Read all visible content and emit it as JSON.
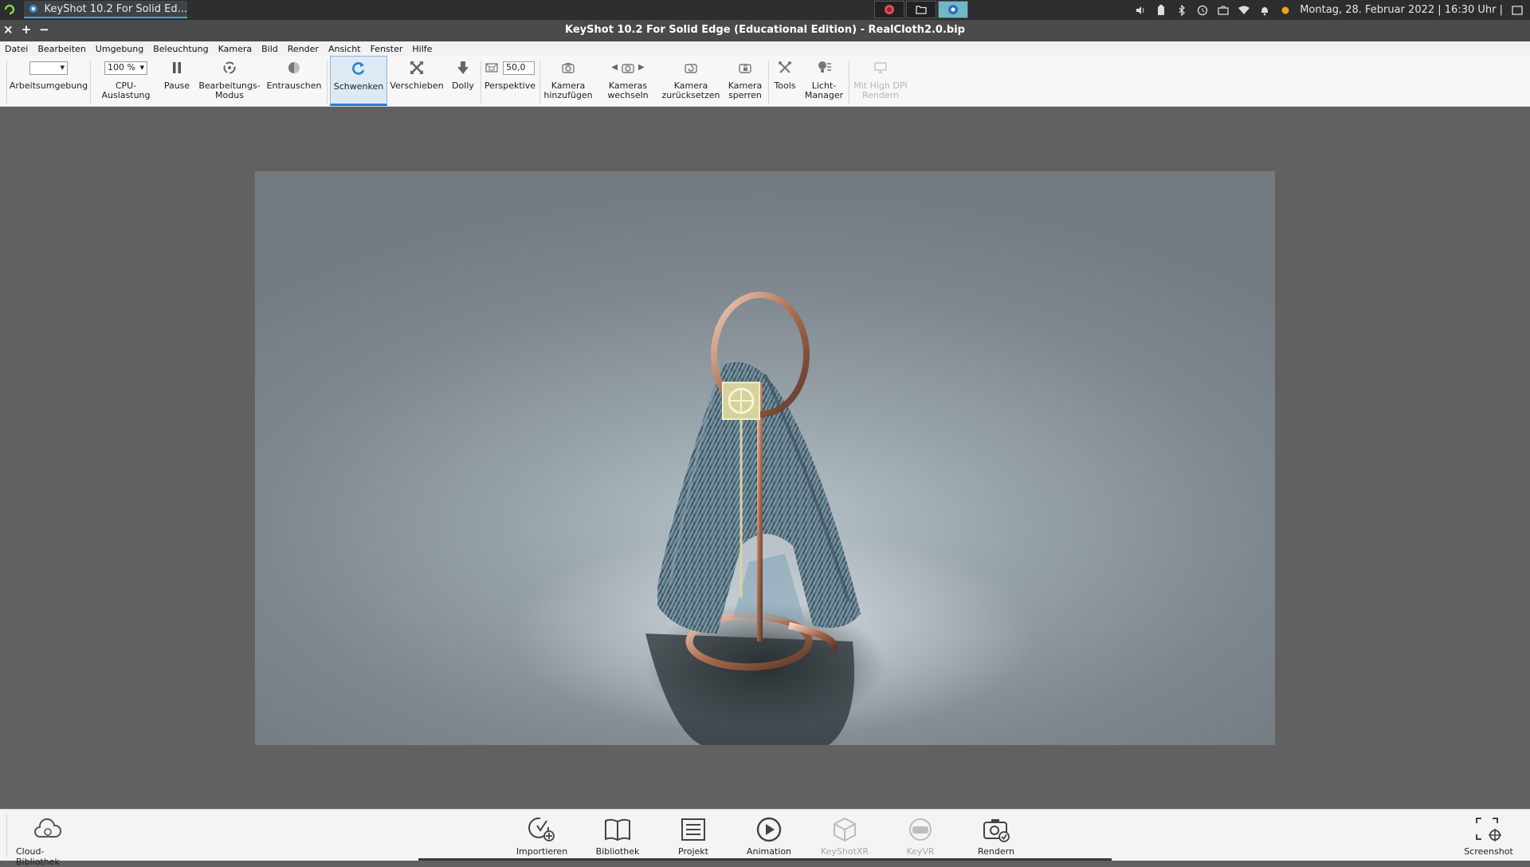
{
  "taskbar": {
    "task_title": "KeyShot 10.2 For Solid Ed...",
    "clock": "Montag, 28. Februar 2022 | 16:30 Uhr |",
    "launchers": [
      "firefox-icon",
      "folder-icon",
      "keyshot-icon"
    ],
    "tray_icons": [
      "volume-icon",
      "battery-icon",
      "bluetooth-icon",
      "clipboard-icon",
      "briefcase-icon",
      "wifi-icon",
      "bell-icon",
      "update-dot-icon"
    ]
  },
  "window": {
    "title": "KeyShot 10.2 For Solid Edge (Educational Edition) - RealCloth2.0.bip",
    "controls": [
      "×",
      "+",
      "−"
    ]
  },
  "menu": [
    "Datei",
    "Bearbeiten",
    "Umgebung",
    "Beleuchtung",
    "Kamera",
    "Bild",
    "Render",
    "Ansicht",
    "Fenster",
    "Hilfe"
  ],
  "toolbar": {
    "arbeitsumgebung": "Arbeitsumgebung",
    "workspace_value": "",
    "cpu_value": "100 %",
    "cpu": "CPU-Auslastung",
    "pause": "Pause",
    "edit_mode_1": "Bearbeitungs-",
    "edit_mode_2": "Modus",
    "denoise": "Entrauschen",
    "tumble": "Schwenken",
    "pan": "Verschieben",
    "dolly": "Dolly",
    "fov_value": "50,0",
    "perspective": "Perspektive",
    "add_camera_1": "Kamera",
    "add_camera_2": "hinzufügen",
    "switch_cameras_1": "Kameras",
    "switch_cameras_2": "wechseln",
    "reset_camera_1": "Kamera",
    "reset_camera_2": "zurücksetzen",
    "lock_camera_1": "Kamera",
    "lock_camera_2": "sperren",
    "tools": "Tools",
    "light_manager_1": "Licht-",
    "light_manager_2": "Manager",
    "high_dpi_1": "Mit High DPI",
    "high_dpi_2": "Rendern"
  },
  "bottombar": {
    "cloud_library": "Cloud-Bibliothek",
    "import": "Importieren",
    "library": "Bibliothek",
    "project": "Projekt",
    "animation": "Animation",
    "keyshotxr": "KeyShotXR",
    "keyvr": "KeyVR",
    "render": "Rendern",
    "screenshot": "Screenshot"
  },
  "colors": {
    "accent": "#2a7fd0",
    "viewport_bg": "#8b959b",
    "app_bg": "#616161",
    "cloth": "#4f6b7a",
    "copper": "#b07a5c"
  }
}
